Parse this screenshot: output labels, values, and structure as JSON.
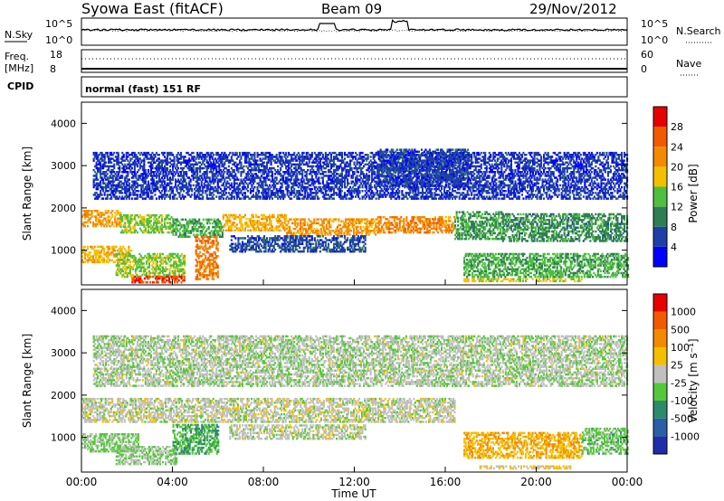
{
  "header": {
    "station": "Syowa East (fitACF)",
    "beam": "Beam 09",
    "date": "29/Nov/2012"
  },
  "noise_panel": {
    "left_label": "N.Sky",
    "right_label": "N.Search",
    "left_ticks": [
      "10^5",
      "10^0"
    ],
    "right_ticks": [
      "10^5",
      "10^0"
    ]
  },
  "freq_panel": {
    "left_label_line1": "Freq.",
    "left_label_line2": "[MHz]",
    "left_ticks": [
      "18",
      "8"
    ],
    "right_label": "Nave",
    "right_ticks": [
      "60",
      "0"
    ]
  },
  "cpid_panel": {
    "label": "CPID",
    "value": "normal (fast) 151 RF"
  },
  "colors": {
    "power_scale": [
      "#0000ff",
      "#1f3fa8",
      "#2e7d55",
      "#4fbf3f",
      "#f3c000",
      "#f38a00",
      "#f25a00",
      "#e80000"
    ],
    "velocity_scale": [
      "#1f2ea8",
      "#2a5fa8",
      "#2e8a6a",
      "#55c83a",
      "#c0c0c0",
      "#f3c000",
      "#f38a00",
      "#f25a00",
      "#e80000"
    ]
  },
  "chart_data": [
    {
      "type": "heatmap",
      "panel": "power",
      "xlabel": "",
      "ylabel": "Slant Range [km]",
      "x_range_hours": [
        0,
        24
      ],
      "ylim": [
        180,
        4500
      ],
      "y_ticks": [
        "4000",
        "3000",
        "2000",
        "1000"
      ],
      "colorbar_label": "Power [dB]",
      "colorbar_ticks": [
        "28",
        "24",
        "20",
        "16",
        "12",
        "8",
        "4"
      ],
      "colorbar_range": [
        0,
        30
      ],
      "regions": [
        {
          "t0": 0.0,
          "t1": 1.7,
          "r0": 1550,
          "r1": 1950,
          "v": 20
        },
        {
          "t0": 1.7,
          "t1": 4.0,
          "r0": 1400,
          "r1": 1850,
          "v": 14
        },
        {
          "t0": 4.0,
          "t1": 6.2,
          "r0": 1300,
          "r1": 1750,
          "v": 12
        },
        {
          "t0": 6.2,
          "t1": 9.0,
          "r0": 1450,
          "r1": 1850,
          "v": 18
        },
        {
          "t0": 9.0,
          "t1": 13.0,
          "r0": 1350,
          "r1": 1750,
          "v": 20
        },
        {
          "t0": 13.0,
          "t1": 16.4,
          "r0": 1400,
          "r1": 1800,
          "v": 21
        },
        {
          "t0": 16.4,
          "t1": 18.5,
          "r0": 1250,
          "r1": 1900,
          "v": 11
        },
        {
          "t0": 18.5,
          "t1": 24.0,
          "r0": 1200,
          "r1": 1850,
          "v": 10
        },
        {
          "t0": 0.0,
          "t1": 2.2,
          "r0": 700,
          "r1": 1100,
          "v": 18
        },
        {
          "t0": 1.5,
          "t1": 4.5,
          "r0": 350,
          "r1": 900,
          "v": 14
        },
        {
          "t0": 2.2,
          "t1": 4.5,
          "r0": 220,
          "r1": 360,
          "v": 26
        },
        {
          "t0": 5.0,
          "t1": 6.0,
          "r0": 300,
          "r1": 1300,
          "v": 22
        },
        {
          "t0": 6.5,
          "t1": 12.5,
          "r0": 950,
          "r1": 1350,
          "v": 6
        },
        {
          "t0": 16.8,
          "t1": 24.0,
          "r0": 350,
          "r1": 900,
          "v": 12
        },
        {
          "t0": 16.8,
          "t1": 22.0,
          "r0": 250,
          "r1": 330,
          "v": 16
        },
        {
          "t0": 13.0,
          "t1": 17.0,
          "r0": 2500,
          "r1": 3400,
          "v": 6
        },
        {
          "t0": 0.5,
          "t1": 24.0,
          "r0": 2200,
          "r1": 3300,
          "v": 5
        }
      ]
    },
    {
      "type": "heatmap",
      "panel": "velocity",
      "xlabel": "Time UT",
      "ylabel": "Slant Range [km]",
      "x_ticks": [
        "00:00",
        "04:00",
        "08:00",
        "12:00",
        "16:00",
        "20:00",
        "00:00"
      ],
      "x_range_hours": [
        0,
        24
      ],
      "ylim": [
        180,
        4500
      ],
      "y_ticks": [
        "4000",
        "3000",
        "2000",
        "1000"
      ],
      "colorbar_label": "Velocity [m s⁻¹]",
      "colorbar_ticks": [
        "1000",
        "500",
        "100",
        "25",
        "-25",
        "-100",
        "-500",
        "-1000"
      ],
      "colorbar_range": [
        -1000,
        1000
      ],
      "regions": [
        {
          "t0": 0.0,
          "t1": 16.4,
          "r0": 1350,
          "r1": 1900,
          "v": 0
        },
        {
          "t0": 0.0,
          "t1": 2.5,
          "r0": 650,
          "r1": 1100,
          "v": -150
        },
        {
          "t0": 1.5,
          "t1": 4.2,
          "r0": 350,
          "r1": 800,
          "v": -100
        },
        {
          "t0": 4.0,
          "t1": 6.0,
          "r0": 600,
          "r1": 1300,
          "v": -300
        },
        {
          "t0": 6.5,
          "t1": 12.5,
          "r0": 950,
          "r1": 1300,
          "v": -10
        },
        {
          "t0": 16.8,
          "t1": 22.0,
          "r0": 500,
          "r1": 1100,
          "v": 300
        },
        {
          "t0": 17.5,
          "t1": 21.5,
          "r0": 250,
          "r1": 330,
          "v": 150
        },
        {
          "t0": 22.0,
          "t1": 24.0,
          "r0": 600,
          "r1": 1200,
          "v": -200
        },
        {
          "t0": 0.5,
          "t1": 24.0,
          "r0": 2200,
          "r1": 3400,
          "v": -50
        }
      ]
    }
  ]
}
